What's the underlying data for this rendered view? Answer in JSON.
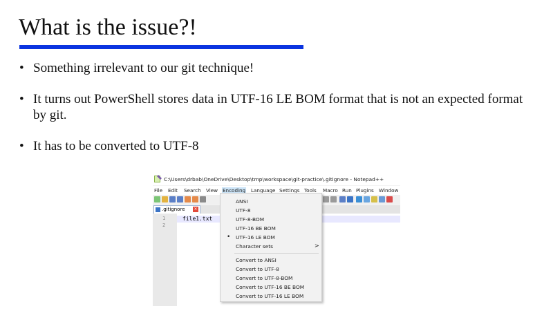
{
  "slide": {
    "title": "What is the issue?!",
    "bullets": [
      "Something irrelevant to our git technique!",
      "It turns out PowerShell stores data in UTF-16 LE BOM format that is not an expected format by git.",
      "It has to be converted to UTF-8"
    ],
    "accent_color": "#0a34e0"
  },
  "notepad": {
    "window_title": "C:\\Users\\drbab\\OneDrive\\Desktop\\tmp\\workspace\\git-practice\\.gitignore - Notepad++",
    "menu": [
      "File",
      "Edit",
      "Search",
      "View",
      "Encoding",
      "Language",
      "Settings",
      "Tools",
      "Macro",
      "Run",
      "Plugins",
      "Window"
    ],
    "active_menu": "Encoding",
    "tab_label": ".gitignore",
    "tab_close_icon": "close-icon",
    "line_numbers": [
      "1",
      "2"
    ],
    "code_line": "file1.txt",
    "encoding_menu": {
      "items_top": [
        "ANSI",
        "UTF-8",
        "UTF-8-BOM",
        "UTF-16 BE BOM",
        "UTF-16 LE BOM"
      ],
      "selected": "UTF-16 LE BOM",
      "selected_marker": "•",
      "character_sets": "Character sets",
      "submenu_arrow": ">",
      "convert_items": [
        "Convert to ANSI",
        "Convert to UTF-8",
        "Convert to UTF-8-BOM",
        "Convert to UTF-16 BE BOM",
        "Convert to UTF-16 LE BOM"
      ]
    }
  }
}
